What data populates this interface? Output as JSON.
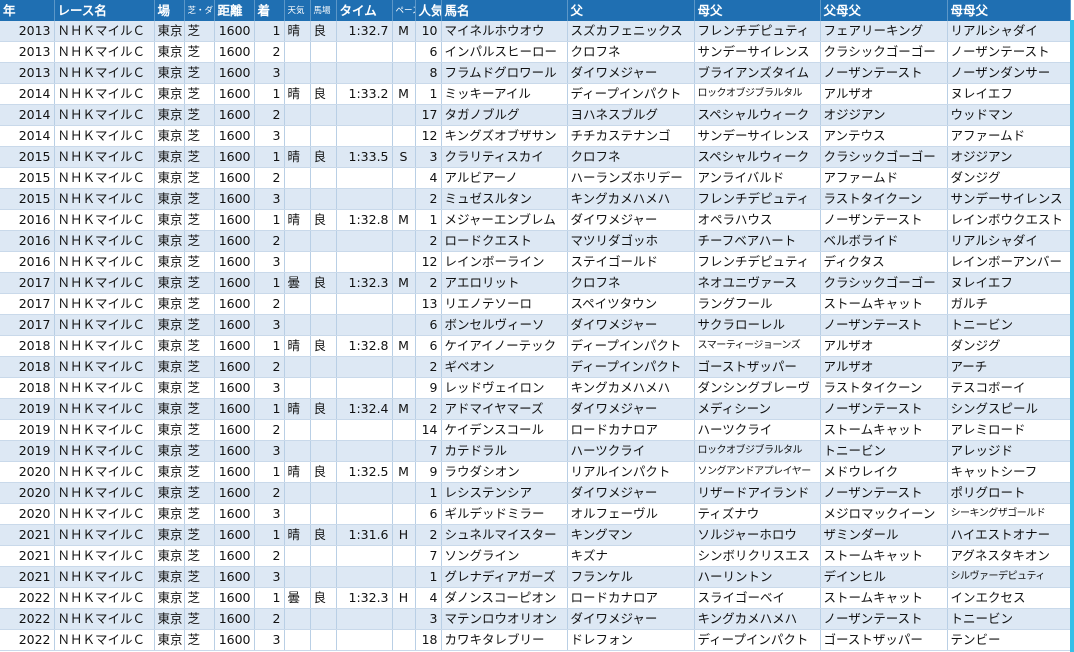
{
  "headers": [
    "年",
    "レース名",
    "場",
    "芝・ダ",
    "距離",
    "着",
    "天気",
    "馬場",
    "タイム",
    "ペース",
    "人気",
    "馬名",
    "父",
    "母父",
    "父母父",
    "母母父"
  ],
  "rows": [
    [
      "2013",
      "ＮＨＫマイルＣ",
      "東京",
      "芝",
      "1600",
      "1",
      "晴",
      "良",
      "1:32.7",
      "M",
      "10",
      "マイネルホウオウ",
      "スズカフェニックス",
      "フレンチデピュティ",
      "フェアリーキング",
      "リアルシャダイ"
    ],
    [
      "2013",
      "ＮＨＫマイルＣ",
      "東京",
      "芝",
      "1600",
      "2",
      "",
      "",
      "",
      "",
      "6",
      "インパルスヒーロー",
      "クロフネ",
      "サンデーサイレンス",
      "クラシックゴーゴー",
      "ノーザンテースト"
    ],
    [
      "2013",
      "ＮＨＫマイルＣ",
      "東京",
      "芝",
      "1600",
      "3",
      "",
      "",
      "",
      "",
      "8",
      "フラムドグロワール",
      "ダイワメジャー",
      "ブライアンズタイム",
      "ノーザンテースト",
      "ノーザンダンサー"
    ],
    [
      "2014",
      "ＮＨＫマイルＣ",
      "東京",
      "芝",
      "1600",
      "1",
      "晴",
      "良",
      "1:33.2",
      "M",
      "1",
      "ミッキーアイル",
      "ディープインパクト",
      "ロックオブジブラルタル",
      "アルザオ",
      "ヌレイエフ"
    ],
    [
      "2014",
      "ＮＨＫマイルＣ",
      "東京",
      "芝",
      "1600",
      "2",
      "",
      "",
      "",
      "",
      "17",
      "タガノブルグ",
      "ヨハネスブルグ",
      "スペシャルウィーク",
      "オジジアン",
      "ウッドマン"
    ],
    [
      "2014",
      "ＮＨＫマイルＣ",
      "東京",
      "芝",
      "1600",
      "3",
      "",
      "",
      "",
      "",
      "12",
      "キングズオブザサン",
      "チチカステナンゴ",
      "サンデーサイレンス",
      "アンテウス",
      "アファームド"
    ],
    [
      "2015",
      "ＮＨＫマイルＣ",
      "東京",
      "芝",
      "1600",
      "1",
      "晴",
      "良",
      "1:33.5",
      "S",
      "3",
      "クラリティスカイ",
      "クロフネ",
      "スペシャルウィーク",
      "クラシックゴーゴー",
      "オジジアン"
    ],
    [
      "2015",
      "ＮＨＫマイルＣ",
      "東京",
      "芝",
      "1600",
      "2",
      "",
      "",
      "",
      "",
      "4",
      "アルビアーノ",
      "ハーランズホリデー",
      "アンライバルド",
      "アファームド",
      "ダンジグ"
    ],
    [
      "2015",
      "ＮＨＫマイルＣ",
      "東京",
      "芝",
      "1600",
      "3",
      "",
      "",
      "",
      "",
      "2",
      "ミュゼスルタン",
      "キングカメハメハ",
      "フレンチデピュティ",
      "ラストタイクーン",
      "サンデーサイレンス"
    ],
    [
      "2016",
      "ＮＨＫマイルＣ",
      "東京",
      "芝",
      "1600",
      "1",
      "晴",
      "良",
      "1:32.8",
      "M",
      "1",
      "メジャーエンブレム",
      "ダイワメジャー",
      "オペラハウス",
      "ノーザンテースト",
      "レインボウクエスト"
    ],
    [
      "2016",
      "ＮＨＫマイルＣ",
      "東京",
      "芝",
      "1600",
      "2",
      "",
      "",
      "",
      "",
      "2",
      "ロードクエスト",
      "マツリダゴッホ",
      "チーフベアハート",
      "ベルボライド",
      "リアルシャダイ"
    ],
    [
      "2016",
      "ＮＨＫマイルＣ",
      "東京",
      "芝",
      "1600",
      "3",
      "",
      "",
      "",
      "",
      "12",
      "レインボーライン",
      "ステイゴールド",
      "フレンチデピュティ",
      "ディクタス",
      "レインボーアンバー"
    ],
    [
      "2017",
      "ＮＨＫマイルＣ",
      "東京",
      "芝",
      "1600",
      "1",
      "曇",
      "良",
      "1:32.3",
      "M",
      "2",
      "アエロリット",
      "クロフネ",
      "ネオユニヴァース",
      "クラシックゴーゴー",
      "ヌレイエフ"
    ],
    [
      "2017",
      "ＮＨＫマイルＣ",
      "東京",
      "芝",
      "1600",
      "2",
      "",
      "",
      "",
      "",
      "13",
      "リエノテソーロ",
      "スペイツタウン",
      "ラングフール",
      "ストームキャット",
      "ガルチ"
    ],
    [
      "2017",
      "ＮＨＫマイルＣ",
      "東京",
      "芝",
      "1600",
      "3",
      "",
      "",
      "",
      "",
      "6",
      "ボンセルヴィーソ",
      "ダイワメジャー",
      "サクラローレル",
      "ノーザンテースト",
      "トニービン"
    ],
    [
      "2018",
      "ＮＨＫマイルＣ",
      "東京",
      "芝",
      "1600",
      "1",
      "晴",
      "良",
      "1:32.8",
      "M",
      "6",
      "ケイアイノーテック",
      "ディープインパクト",
      "スマーティージョーンズ",
      "アルザオ",
      "ダンジグ"
    ],
    [
      "2018",
      "ＮＨＫマイルＣ",
      "東京",
      "芝",
      "1600",
      "2",
      "",
      "",
      "",
      "",
      "2",
      "ギベオン",
      "ディープインパクト",
      "ゴーストザッパー",
      "アルザオ",
      "アーチ"
    ],
    [
      "2018",
      "ＮＨＫマイルＣ",
      "東京",
      "芝",
      "1600",
      "3",
      "",
      "",
      "",
      "",
      "9",
      "レッドヴェイロン",
      "キングカメハメハ",
      "ダンシングブレーヴ",
      "ラストタイクーン",
      "テスコボーイ"
    ],
    [
      "2019",
      "ＮＨＫマイルＣ",
      "東京",
      "芝",
      "1600",
      "1",
      "晴",
      "良",
      "1:32.4",
      "M",
      "2",
      "アドマイヤマーズ",
      "ダイワメジャー",
      "メディシーン",
      "ノーザンテースト",
      "シングスピール"
    ],
    [
      "2019",
      "ＮＨＫマイルＣ",
      "東京",
      "芝",
      "1600",
      "2",
      "",
      "",
      "",
      "",
      "14",
      "ケイデンスコール",
      "ロードカナロア",
      "ハーツクライ",
      "ストームキャット",
      "アレミロード"
    ],
    [
      "2019",
      "ＮＨＫマイルＣ",
      "東京",
      "芝",
      "1600",
      "3",
      "",
      "",
      "",
      "",
      "7",
      "カテドラル",
      "ハーツクライ",
      "ロックオブジブラルタル",
      "トニービン",
      "アレッジド"
    ],
    [
      "2020",
      "ＮＨＫマイルＣ",
      "東京",
      "芝",
      "1600",
      "1",
      "晴",
      "良",
      "1:32.5",
      "M",
      "9",
      "ラウダシオン",
      "リアルインパクト",
      "ソングアンドアプレイヤー",
      "メドウレイク",
      "キャットシーフ"
    ],
    [
      "2020",
      "ＮＨＫマイルＣ",
      "東京",
      "芝",
      "1600",
      "2",
      "",
      "",
      "",
      "",
      "1",
      "レシステンシア",
      "ダイワメジャー",
      "リザードアイランド",
      "ノーザンテースト",
      "ポリグロート"
    ],
    [
      "2020",
      "ＮＨＫマイルＣ",
      "東京",
      "芝",
      "1600",
      "3",
      "",
      "",
      "",
      "",
      "6",
      "ギルデッドミラー",
      "オルフェーヴル",
      "ティズナウ",
      "メジロマックイーン",
      "シーキングザゴールド"
    ],
    [
      "2021",
      "ＮＨＫマイルＣ",
      "東京",
      "芝",
      "1600",
      "1",
      "晴",
      "良",
      "1:31.6",
      "H",
      "2",
      "シュネルマイスター",
      "キングマン",
      "ソルジャーホロウ",
      "ザミンダール",
      "ハイエストオナー"
    ],
    [
      "2021",
      "ＮＨＫマイルＣ",
      "東京",
      "芝",
      "1600",
      "2",
      "",
      "",
      "",
      "",
      "7",
      "ソングライン",
      "キズナ",
      "シンボリクリスエス",
      "ストームキャット",
      "アグネスタキオン"
    ],
    [
      "2021",
      "ＮＨＫマイルＣ",
      "東京",
      "芝",
      "1600",
      "3",
      "",
      "",
      "",
      "",
      "1",
      "グレナディアガーズ",
      "フランケル",
      "ハーリントン",
      "デインヒル",
      "シルヴァーデピュティ"
    ],
    [
      "2022",
      "ＮＨＫマイルＣ",
      "東京",
      "芝",
      "1600",
      "1",
      "曇",
      "良",
      "1:32.3",
      "H",
      "4",
      "ダノンスコーピオン",
      "ロードカナロア",
      "スライゴーベイ",
      "ストームキャット",
      "インエクセス"
    ],
    [
      "2022",
      "ＮＨＫマイルＣ",
      "東京",
      "芝",
      "1600",
      "2",
      "",
      "",
      "",
      "",
      "3",
      "マテンロウオリオン",
      "ダイワメジャー",
      "キングカメハメハ",
      "ノーザンテースト",
      "トニービン"
    ],
    [
      "2022",
      "ＮＨＫマイルＣ",
      "東京",
      "芝",
      "1600",
      "3",
      "",
      "",
      "",
      "",
      "18",
      "カワキタレブリー",
      "ドレフォン",
      "ディープインパクト",
      "ゴーストザッパー",
      "テンビー"
    ]
  ],
  "colors": {
    "header_bg": "#1f6fb2",
    "row_alt": "#dde8f4"
  }
}
